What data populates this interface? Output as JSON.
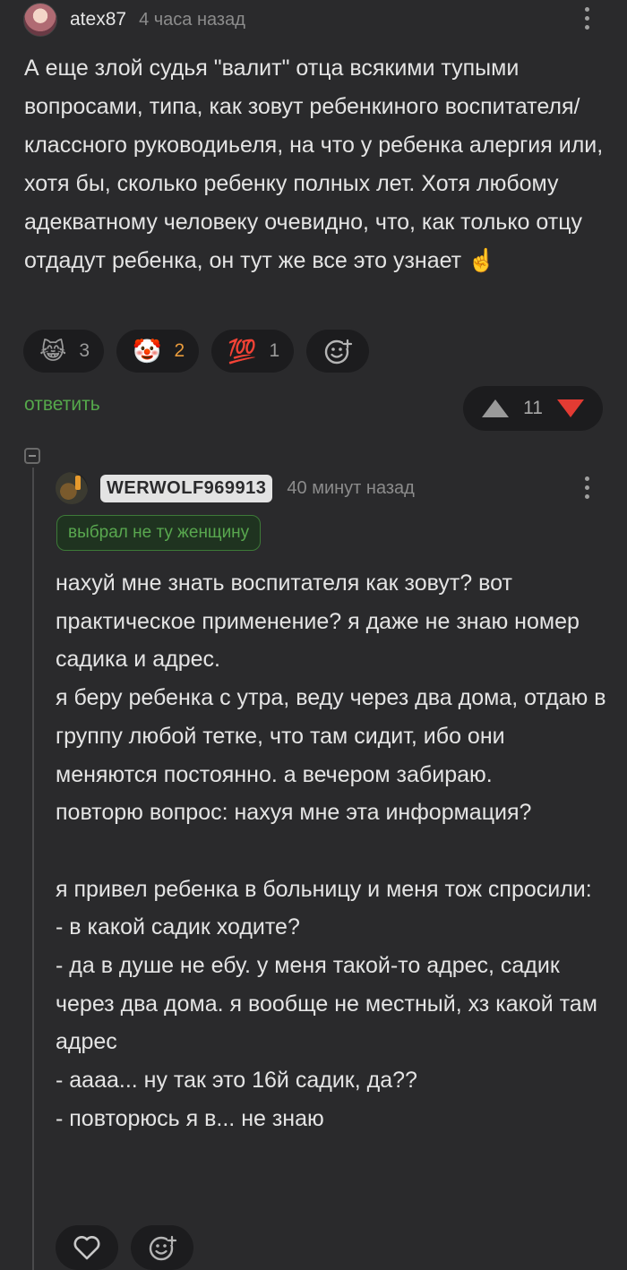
{
  "comment": {
    "username": "atex87",
    "time": "4 часа назад",
    "text": "А еще злой судья \"валит\" отца всякими тупыми вопросами, типа, как зовут ребенкиного воспитателя/классного руководиьеля, на что у ребенка алергия или, хотя бы, сколько ребенку полных лет. Хотя любому адекватному человеку очевидно, что, как только отцу отдадут ребенка, он тут же все это узнает ☝️",
    "reactions": [
      {
        "emoji": "😹",
        "count": "3"
      },
      {
        "emoji": "🤡",
        "count": "2"
      },
      {
        "emoji": "💯",
        "count": "1"
      }
    ],
    "reply_label": "ответить",
    "rating": "11",
    "colors": {
      "reply": "#55a84b",
      "down": "#e33b33",
      "active_reaction": "#e89b3c"
    }
  },
  "reply": {
    "username": "WERWOLF969913",
    "time": "40 минут назад",
    "badge": "выбрал не ту женщину",
    "text": "нахуй мне знать воспитателя как зовут? вот практическое применение? я даже не знаю номер садика и адрес.\nя беру ребенка с утра, веду через два дома, отдаю в группу любой тетке, что там сидит, ибо они меняются постоянно. а вечером забираю.\nповторю вопрос: нахуя мне эта информация?\n\nя привел ребенка в больницу и меня тож спросили:\n- в какой садик ходите?\n- да в душе не ебу. у меня такой-то адрес, садик через два дома. я вообще не местный, хз какой там адрес\n- аааа... ну так это 16й садик, да??\n- повторюсь я в... не знаю"
  }
}
